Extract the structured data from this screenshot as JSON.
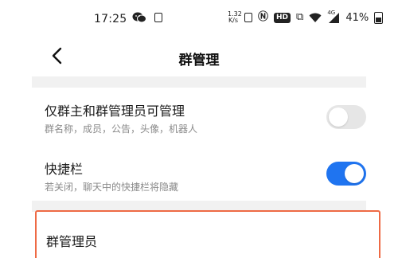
{
  "status_bar": {
    "time": "17:25",
    "left_icons": [
      "wechat-icon",
      "notification-box-icon"
    ],
    "network_speed_value": "1.32",
    "network_speed_unit": "K/s",
    "hd_label": "HD",
    "signal_type": "4G",
    "battery_percent": "41%"
  },
  "nav": {
    "title": "群管理"
  },
  "settings": {
    "admin_only": {
      "title": "仅群主和群管理员可管理",
      "subtitle": "群名称，成员，公告，头像，机器人",
      "enabled": false
    },
    "shortcut_bar": {
      "title": "快捷栏",
      "subtitle": "若关闭，聊天中的快捷栏将隐藏",
      "enabled": true
    },
    "admins": {
      "label": "群管理员"
    }
  },
  "colors": {
    "toggle_on": "#1f74f0",
    "toggle_off": "#e6e6e6",
    "highlight_border": "#ee6a45"
  }
}
